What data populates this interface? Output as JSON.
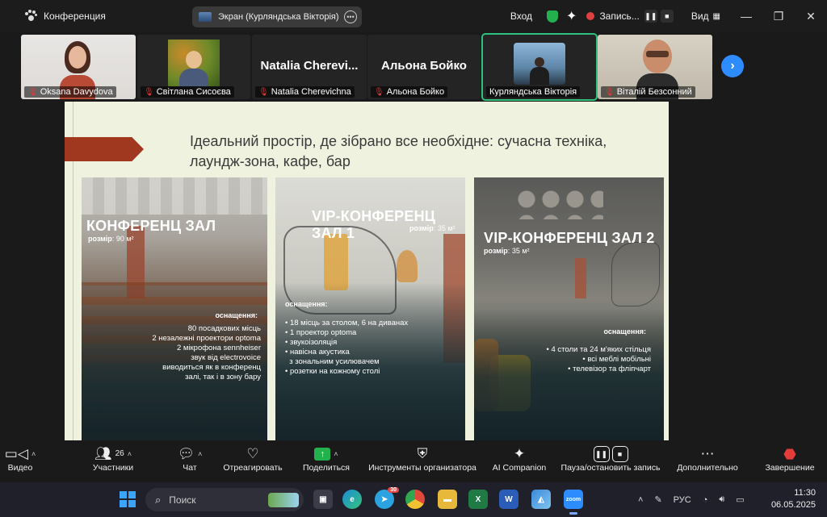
{
  "titlebar": {
    "app_name": "Конференция",
    "share_title": "Экран (Курляндська Вікторія)",
    "signin": "Вход",
    "recording_label": "Запись...",
    "view_label": "Вид"
  },
  "participants": [
    {
      "name": "Oksana Davydova",
      "video": true
    },
    {
      "name": "Світлана Сисоєва",
      "video": true
    },
    {
      "name": "Natalia Cherevichna",
      "short": "Natalia  Cherevi...",
      "video": false
    },
    {
      "name": "Альона Бойко",
      "short": "Альона Бойко",
      "video": false
    },
    {
      "name": "Курляндська Вікторія",
      "video": true,
      "active": true
    },
    {
      "name": "Віталій Безсонний",
      "video": true
    }
  ],
  "slide": {
    "headline": "Ідеальний простір, де зібрано все  необхідне: сучасна техніка, лаундж-зона, кафе, бар",
    "panels": [
      {
        "title": "КОНФЕРЕНЦ ЗАЛ",
        "size_label": "розмір",
        "size_value": "90 м²",
        "equip_heading": "оснащення:",
        "items": [
          "80 посадкових місць",
          "2 незалежні проектори optoma",
          "2 мікрофона sennheiser",
          "звук від electrovoice",
          "виводиться як в конференц",
          "залі, так і в зону бару"
        ]
      },
      {
        "title": "VIP-КОНФЕРЕНЦ ЗАЛ 1",
        "size_label": "розмір",
        "size_value": "35 м²",
        "equip_heading": "оснащення:",
        "items": [
          "18 місць за столом, 6 на диванах",
          "1 проектор optoma",
          "звукоізоляція",
          "навісна акустика",
          "з зональним усилювачем",
          "розетки на кожному столі"
        ]
      },
      {
        "title": "VIP-КОНФЕРЕНЦ ЗАЛ 2",
        "size_label": "розмір",
        "size_value": "35 м²",
        "equip_heading": "оснащення:",
        "items": [
          "4 столи та 24 м'яких стільця",
          "всі меблі мобільні",
          "телевізор та фліпчарт"
        ]
      }
    ]
  },
  "toolbar": {
    "video": "Видео",
    "participants": "Участники",
    "participants_count": "26",
    "chat": "Чат",
    "react": "Отреагировать",
    "share": "Поделиться",
    "host_tools": "Инструменты организатора",
    "ai": "AI Companion",
    "pause_record": "Пауза/остановить запись",
    "more": "Дополнительно",
    "end": "Завершение"
  },
  "taskbar": {
    "search_placeholder": "Поиск",
    "telegram_badge": "30",
    "zoom_label": "zoom",
    "lang": "РУС",
    "time": "11:30",
    "date": "06.05.2025"
  },
  "colors": {
    "accent_green": "#2ec27e",
    "arrow_red": "#a0381f",
    "slide_bg": "#eef2de"
  }
}
